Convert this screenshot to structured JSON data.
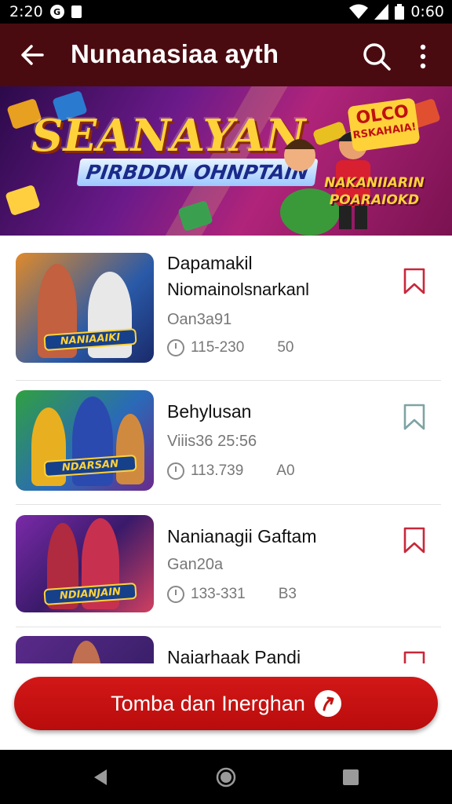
{
  "status_bar": {
    "time": "2:20",
    "battery_text": "0:60",
    "icons": [
      "notification-icon",
      "sim-icon",
      "wifi-icon",
      "signal-icon",
      "battery-icon"
    ]
  },
  "app_bar": {
    "title": "Nunanasiaa ayth",
    "icons": [
      "back-arrow-icon",
      "search-icon",
      "more-vert-icon"
    ],
    "background": "#4a0b10"
  },
  "banner": {
    "headline": "SEANAYAN",
    "subheadline": "PIRBDDN OHNPTAIN",
    "badge_top": "OLCO",
    "badge_bottom": "RSKAHAIA!",
    "tagline_1": "NAKANIIARIN",
    "tagline_2": "POARAIOKD"
  },
  "items": [
    {
      "title": "Dapamakil",
      "subtitle": "Niomainolsnarkanl",
      "meta": "Oan3a91",
      "duration": "115-230",
      "count": "50",
      "thumb_label": "NANIAAIKI",
      "bookmark_color": "#c8283a"
    },
    {
      "title": "Behylusan",
      "subtitle": "",
      "meta": "Viiis36 25:56",
      "duration": "113.739",
      "count": "A0",
      "thumb_label": "NDARSAN",
      "bookmark_color": "#7fa3a3"
    },
    {
      "title": "Nanianagii Gaftam",
      "subtitle": "",
      "meta": "Gan20a",
      "duration": "133-331",
      "count": "B3",
      "thumb_label": "NDIANJAIN",
      "bookmark_color": "#c8283a"
    },
    {
      "title": "Naiarhaak Pandi",
      "subtitle": "",
      "meta": "",
      "duration": "",
      "count": "",
      "thumb_label": "",
      "bookmark_color": "#c8283a"
    }
  ],
  "cta": {
    "label": "Tomba dan Inerghan",
    "background": "#c41212"
  },
  "nav_bar": {
    "icons": [
      "nav-back-icon",
      "nav-home-icon",
      "nav-recents-icon"
    ]
  }
}
